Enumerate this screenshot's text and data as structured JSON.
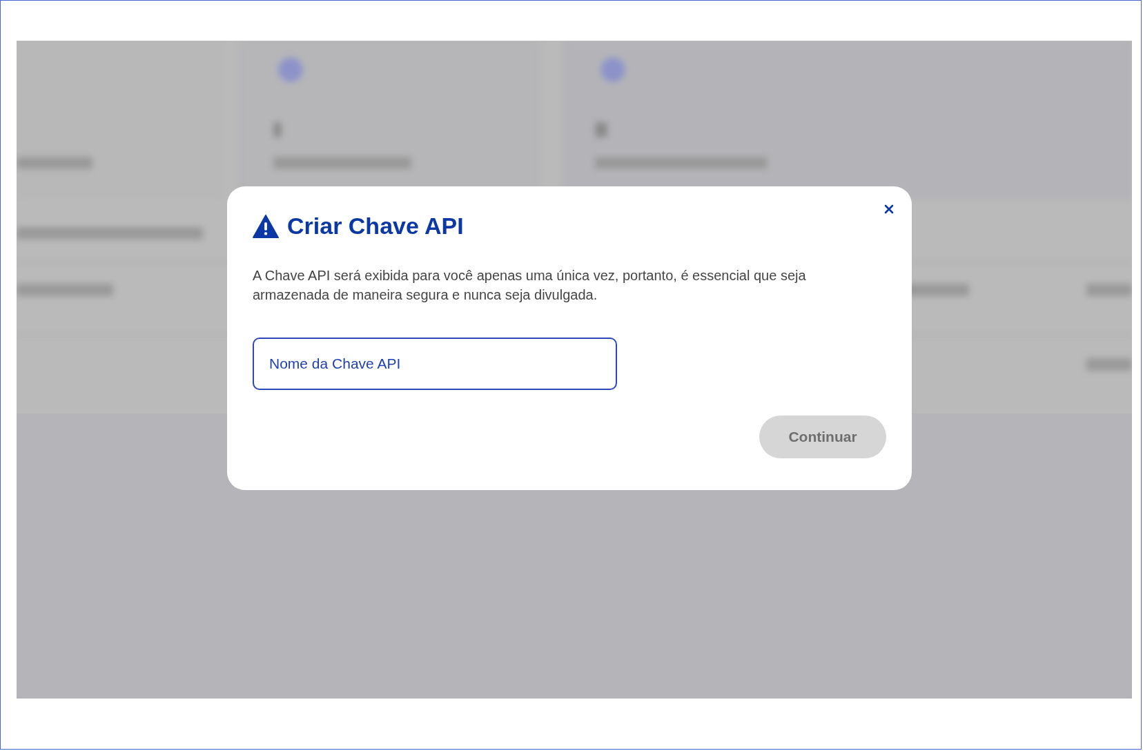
{
  "dialog": {
    "title": "Criar Chave API",
    "message": "A Chave API será exibida para você apenas uma única vez, portanto, é essencial que seja armazenada de maneira segura e nunca seja divulgada.",
    "field": {
      "placeholder": "Nome da Chave API"
    },
    "button": {
      "label": "Continuar",
      "disabled": true
    }
  }
}
